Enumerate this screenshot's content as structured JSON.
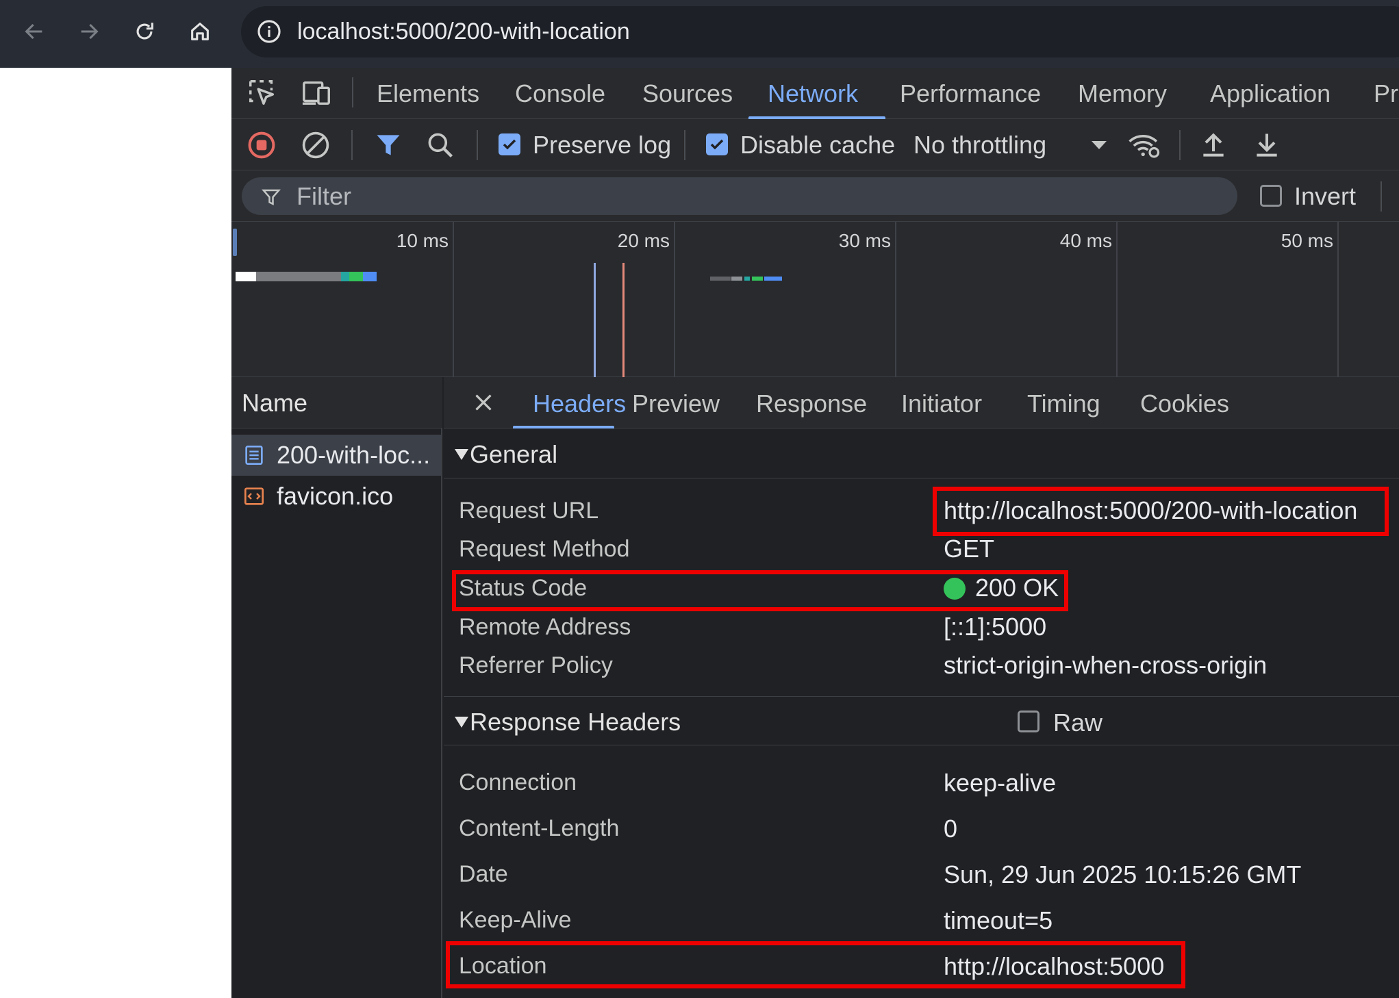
{
  "browser": {
    "address": "localhost:5000/200-with-location"
  },
  "devtools": {
    "tabs": [
      "Elements",
      "Console",
      "Sources",
      "Network",
      "Performance",
      "Memory",
      "Application",
      "Pri"
    ],
    "active_tab": "Network",
    "toolbar": {
      "preserve_log_label": "Preserve log",
      "preserve_log_checked": true,
      "disable_cache_label": "Disable cache",
      "disable_cache_checked": true,
      "throttling": "No throttling"
    },
    "filter": {
      "placeholder": "Filter",
      "invert_label": "Invert",
      "invert_checked": false
    },
    "overview": {
      "ticks": [
        "10 ms",
        "20 ms",
        "30 ms",
        "40 ms",
        "50 ms"
      ]
    },
    "request_list": {
      "column_header": "Name",
      "requests": [
        {
          "name": "200-with-loc...",
          "type": "document",
          "selected": true
        },
        {
          "name": "favicon.ico",
          "type": "script",
          "selected": false
        }
      ]
    },
    "details": {
      "tabs": [
        "Headers",
        "Preview",
        "Response",
        "Initiator",
        "Timing",
        "Cookies"
      ],
      "active_tab": "Headers",
      "general": {
        "title": "General",
        "rows": [
          {
            "key": "Request URL",
            "value": "http://localhost:5000/200-with-location"
          },
          {
            "key": "Request Method",
            "value": "GET"
          },
          {
            "key": "Status Code",
            "value": "200 OK"
          },
          {
            "key": "Remote Address",
            "value": "[::1]:5000"
          },
          {
            "key": "Referrer Policy",
            "value": "strict-origin-when-cross-origin"
          }
        ]
      },
      "response_headers": {
        "title": "Response Headers",
        "raw_label": "Raw",
        "raw_checked": false,
        "rows": [
          {
            "key": "Connection",
            "value": "keep-alive"
          },
          {
            "key": "Content-Length",
            "value": "0"
          },
          {
            "key": "Date",
            "value": "Sun, 29 Jun 2025 10:15:26 GMT"
          },
          {
            "key": "Keep-Alive",
            "value": "timeout=5"
          },
          {
            "key": "Location",
            "value": "http://localhost:5000"
          }
        ]
      }
    }
  },
  "colors": {
    "accent": "#7cacf8",
    "highlight": "#ee0000",
    "status_ok": "#34c35a",
    "record_stop": "#e46962"
  }
}
